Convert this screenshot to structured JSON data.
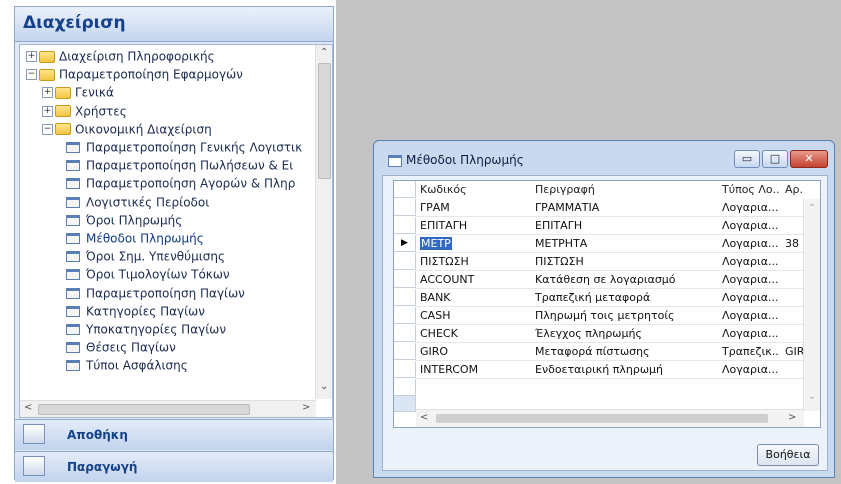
{
  "nav": {
    "title": "Διαχείριση",
    "tree": [
      {
        "label": "Διαχείριση Πληροφορικής",
        "expand": "+",
        "kind": "folder"
      },
      {
        "label": "Παραμετροποίηση Εφαρμογών",
        "expand": "−",
        "kind": "folder"
      },
      {
        "label": "Γενικά",
        "expand": "+",
        "kind": "folder"
      },
      {
        "label": "Χρήστες",
        "expand": "+",
        "kind": "folder"
      },
      {
        "label": "Οικονομική Διαχείριση",
        "expand": "−",
        "kind": "folder"
      },
      {
        "label": "Παραμετροποίηση Γενικής Λογιστικ",
        "kind": "form"
      },
      {
        "label": "Παραμετροποίηση Πωλήσεων & Ει",
        "kind": "form"
      },
      {
        "label": "Παραμετροποίηση Αγορών & Πληρ",
        "kind": "form"
      },
      {
        "label": "Λογιστικές Περίοδοι",
        "kind": "form"
      },
      {
        "label": "Όροι Πληρωμής",
        "kind": "form"
      },
      {
        "label": "Μέθοδοι Πληρωμής",
        "kind": "form"
      },
      {
        "label": "Όροι Σημ. Υπενθύμισης",
        "kind": "form"
      },
      {
        "label": "Όροι Τιμολογίων Τόκων",
        "kind": "form"
      },
      {
        "label": "Παραμετροποίηση Παγίων",
        "kind": "form"
      },
      {
        "label": "Κατηγορίες Παγίων",
        "kind": "form"
      },
      {
        "label": "Υποκατηγορίες Παγίων",
        "kind": "form"
      },
      {
        "label": "Θέσεις Παγίων",
        "kind": "form"
      },
      {
        "label": "Τύποι Ασφάλισης",
        "kind": "form"
      }
    ],
    "splitter": "••••••••",
    "buttons": [
      {
        "label": "Αποθήκη"
      },
      {
        "label": "Παραγωγή"
      }
    ]
  },
  "dialog": {
    "title": "Μέθοδοι Πληρωμής",
    "columns": [
      "Κωδικός",
      "Περιγραφή",
      "Τύπος Λο...",
      "Αρ."
    ],
    "rows": [
      [
        "ΓΡΑΜ",
        "ΓΡΑΜΜΑΤΙΑ",
        "Λογαρια...",
        ""
      ],
      [
        "ΕΠΙΤΑΓΗ",
        "ΕΠΙΤΑΓΗ",
        "Λογαρια...",
        ""
      ],
      [
        "ΜΕΤΡ",
        "ΜΕΤΡΗΤΑ",
        "Λογαρια...",
        "38"
      ],
      [
        "ΠΙΣΤΩΣΗ",
        "ΠΙΣΤΩΣΗ",
        "Λογαρια...",
        ""
      ],
      [
        "ACCOUNT",
        "Κατάθεση σε λογαριασμό",
        "Λογαρια...",
        ""
      ],
      [
        "BANK",
        "Τραπεζική μεταφορά",
        "Λογαρια...",
        ""
      ],
      [
        "CASH",
        "Πληρωμή τοις μετρητοίς",
        "Λογαρια...",
        ""
      ],
      [
        "CHECK",
        "Έλεγχος πληρωμής",
        "Λογαρια...",
        ""
      ],
      [
        "GIRO",
        "Μεταφορά πίστωσης",
        "Τραπεζικ...",
        "GIR"
      ],
      [
        "INTERCOM",
        "Ενδοεταιρική πληρωμή",
        "Λογαρια...",
        ""
      ]
    ],
    "current_row_marker": "▶",
    "help_label": "Βοήθεια",
    "minimize_glyph": "▭",
    "maximize_glyph": "□",
    "close_glyph": "✕"
  }
}
